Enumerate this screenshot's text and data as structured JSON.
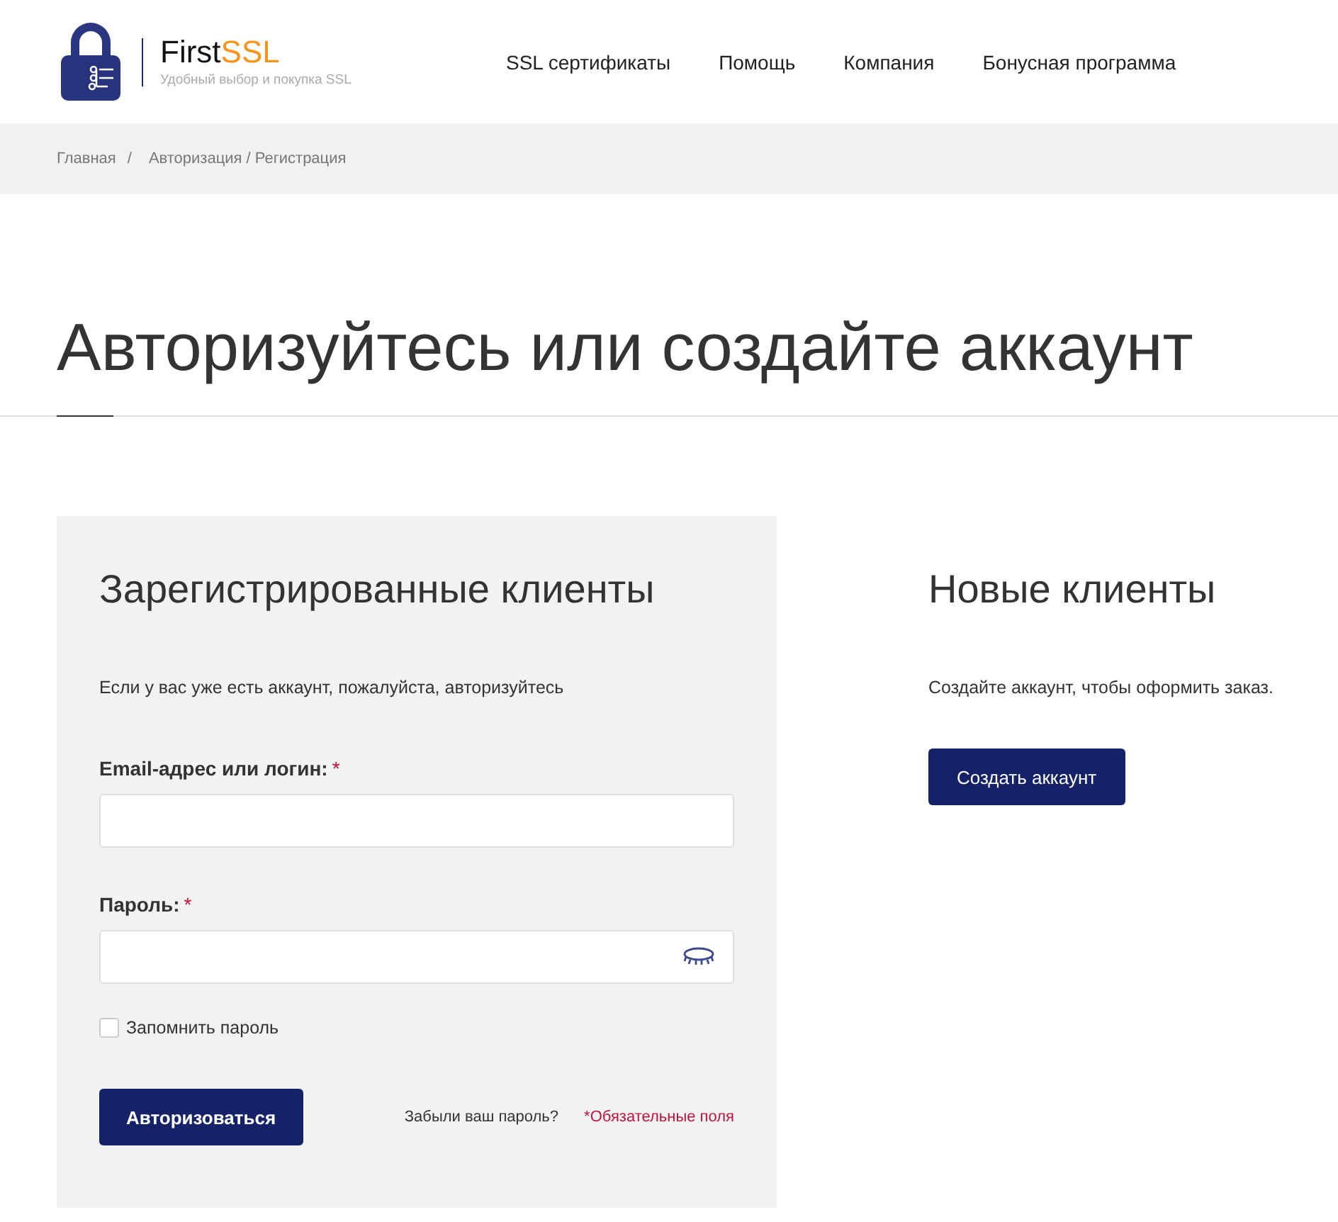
{
  "brand": {
    "name": "First",
    "accent": "SSL",
    "tagline": "Удобный выбор и покупка SSL"
  },
  "nav": [
    {
      "label": "SSL сертификаты"
    },
    {
      "label": "Помощь"
    },
    {
      "label": "Компания"
    },
    {
      "label": "Бонусная программа"
    }
  ],
  "breadcrumbs": {
    "items": [
      "Главная",
      "Авторизация / Регистрация"
    ],
    "separator": "/"
  },
  "page_title": "Авторизуйтесь или создайте аккаунт",
  "login": {
    "title": "Зарегистрированные клиенты",
    "intro": "Если у вас уже есть аккаунт, пожалуйста, авторизуйтесь",
    "fields": [
      {
        "label": "Email-адрес или логин:",
        "required_mark": "*",
        "kind": "text"
      },
      {
        "label": "Пароль:",
        "required_mark": "*",
        "kind": "password"
      }
    ],
    "remember": {
      "label": "Запомнить пароль",
      "checked": false
    },
    "submit": "Авторизоваться",
    "forgot": "Забыли ваш пароль?",
    "required_note": "*Обязательные поля"
  },
  "register": {
    "title": "Новые клиенты",
    "text": "Создайте аккаунт, чтобы оформить заказ.",
    "button": "Создать аккаунт"
  }
}
